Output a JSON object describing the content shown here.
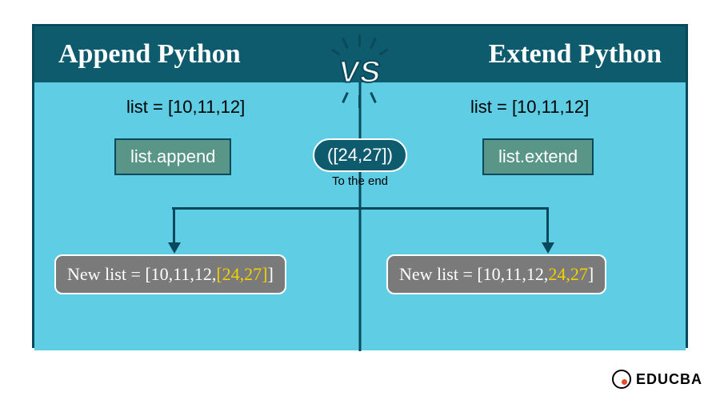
{
  "header": {
    "left_title": "Append Python",
    "right_title": "Extend Python",
    "vs": "VS"
  },
  "left": {
    "init": "list = [10,11,12]",
    "method": "list.append",
    "result_prefix": "New list = [10,11,12,",
    "result_highlight": "[24,27]",
    "result_suffix": "]"
  },
  "right": {
    "init": "list = [10,11,12]",
    "method": "list.extend",
    "result_prefix": "New list = [10,11,12,",
    "result_highlight": "24,27",
    "result_suffix": "]"
  },
  "center": {
    "argument": "([24,27])",
    "sublabel": "To the end"
  },
  "brand": "EDUCBA"
}
